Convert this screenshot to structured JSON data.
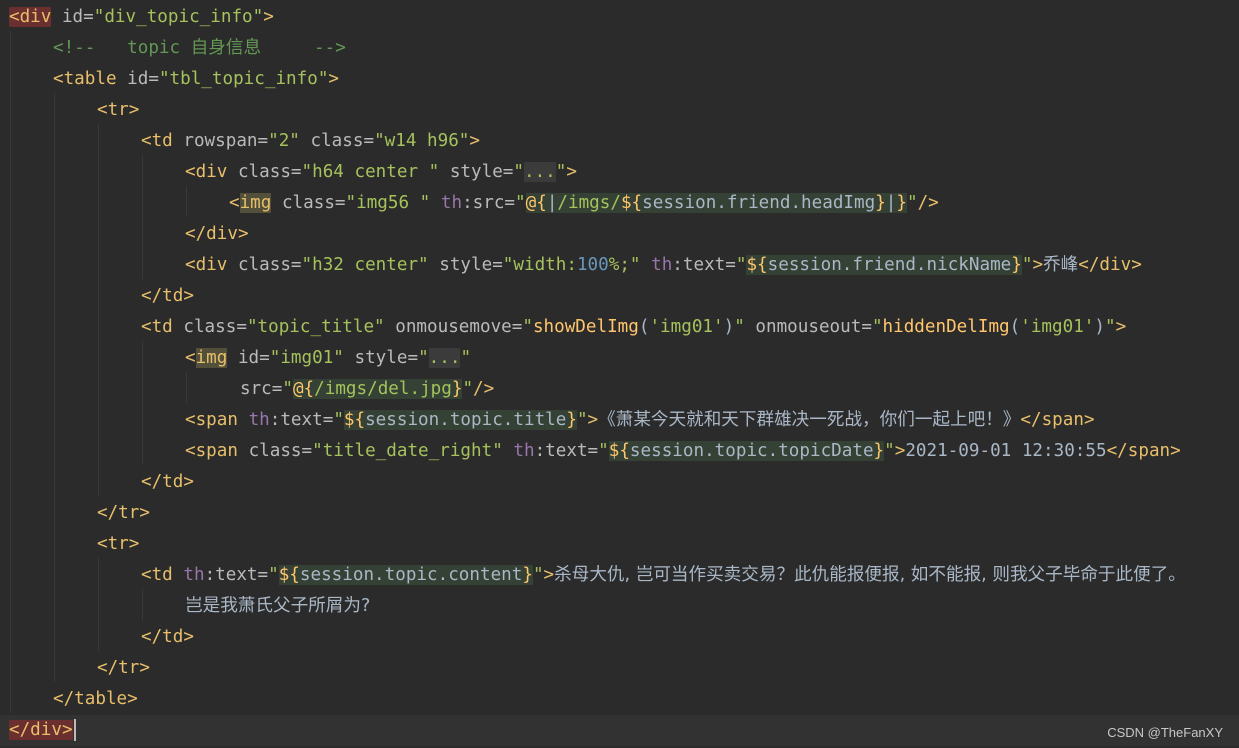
{
  "editor": {
    "language": "HTML (Thymeleaf)",
    "theme": "Darcula",
    "watermark": "CSDN @TheFanXY",
    "lines": [
      {
        "text": "<div id=\"div_topic_info\">"
      },
      {
        "text": "<!--   topic 自身信息     -->"
      },
      {
        "text": "<table id=\"tbl_topic_info\">"
      },
      {
        "text": "<tr>"
      },
      {
        "text": "<td rowspan=\"2\" class=\"w14 h96\">"
      },
      {
        "text": "<div class=\"h64 center \" style=\"...\">"
      },
      {
        "text": "<img class=\"img56 \" th:src=\"@{|/imgs/${session.friend.headImg}|}\"/>"
      },
      {
        "text": "</div>"
      },
      {
        "text": "<div class=\"h32 center\" style=\"width:100%;\" th:text=\"${session.friend.nickName}\">乔峰</div>"
      },
      {
        "text": "</td>"
      },
      {
        "text": "<td class=\"topic_title\" onmousemove=\"showDelImg('img01')\" onmouseout=\"hiddenDelImg('img01')\">"
      },
      {
        "text": "<img id=\"img01\" style=\"...\""
      },
      {
        "text": "src=\"@{/imgs/del.jpg}\"/>"
      },
      {
        "text": "<span th:text=\"${session.topic.title}\">《萧某今天就和天下群雄决一死战，你们一起上吧！》</span>"
      },
      {
        "text": "<span class=\"title_date_right\" th:text=\"${session.topic.topicDate}\">2021-09-01 12:30:55</span>"
      },
      {
        "text": "</td>"
      },
      {
        "text": "</tr>"
      },
      {
        "text": "<tr>"
      },
      {
        "text": "<td th:text=\"${session.topic.content}\">杀母大仇, 岂可当作买卖交易？此仇能报便报, 如不能报, 则我父子毕命于此便了。"
      },
      {
        "text": "岂是我萧氏父子所屑为?"
      },
      {
        "text": "</td>"
      },
      {
        "text": "</tr>"
      },
      {
        "text": "</table>"
      },
      {
        "text": "</div>"
      }
    ]
  },
  "colors": {
    "background": "#2b2b2b",
    "tag": "#e8bf6a",
    "attribute": "#bababa",
    "string": "#a5c25c",
    "comment": "#629755",
    "text": "#a9b7c6",
    "namespace": "#9876aa",
    "function": "#ffc66d",
    "number": "#6897bb"
  }
}
